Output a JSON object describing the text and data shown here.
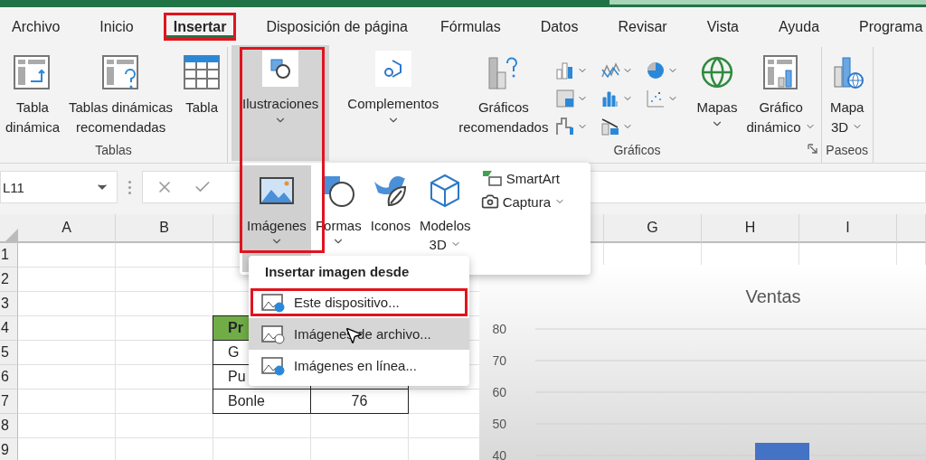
{
  "tabs": [
    {
      "label": "Archivo",
      "selected": false,
      "highlighted": false
    },
    {
      "label": "Inicio",
      "selected": false,
      "highlighted": false
    },
    {
      "label": "Insertar",
      "selected": true,
      "highlighted": true
    },
    {
      "label": "Disposición de página",
      "selected": false,
      "highlighted": false
    },
    {
      "label": "Fórmulas",
      "selected": false,
      "highlighted": false
    },
    {
      "label": "Datos",
      "selected": false,
      "highlighted": false
    },
    {
      "label": "Revisar",
      "selected": false,
      "highlighted": false
    },
    {
      "label": "Vista",
      "selected": false,
      "highlighted": false
    },
    {
      "label": "Ayuda",
      "selected": false,
      "highlighted": false
    },
    {
      "label": "Programa",
      "selected": false,
      "highlighted": false
    }
  ],
  "ribbon": {
    "groups": [
      {
        "label": "Tablas",
        "buttons": [
          {
            "kind": "large",
            "label": "Tabla\ndinámica"
          },
          {
            "kind": "large",
            "label": "Tablas dinámicas\nrecomendadas"
          },
          {
            "kind": "large",
            "label": "Tabla"
          }
        ]
      },
      {
        "buttons": [
          {
            "kind": "boxed",
            "label": "Ilustraciones",
            "dropdown": true,
            "pressed": true,
            "highlighted": true
          }
        ]
      },
      {
        "buttons": [
          {
            "kind": "boxed",
            "label": "Complementos",
            "dropdown": true,
            "pressed": false
          }
        ]
      },
      {
        "label": "Gráficos",
        "launcher": true,
        "buttons": [
          {
            "kind": "large",
            "label": "Gráficos\nrecomendados"
          },
          {
            "kind": "gallery"
          },
          {
            "kind": "large",
            "label": "Mapas",
            "dropdown": true
          },
          {
            "kind": "large",
            "label": "Gráfico\ndinámico",
            "dropdown": true
          }
        ]
      },
      {
        "label": "Paseos",
        "buttons": [
          {
            "kind": "large",
            "label": "Mapa\n3D",
            "dropdown": true
          }
        ]
      }
    ]
  },
  "formula_bar": {
    "name_box": "L11"
  },
  "illustrations_menu": {
    "items": [
      {
        "label": "Imágenes",
        "selected": true,
        "dropdown": true
      },
      {
        "label": "Formas",
        "selected": false,
        "dropdown": true
      },
      {
        "label": "Iconos",
        "selected": false,
        "dropdown": false
      },
      {
        "label": "Modelos\n3D",
        "selected": false,
        "dropdown": true
      }
    ],
    "side_items": [
      {
        "label": "SmartArt",
        "dropdown": false
      },
      {
        "label": "Captura",
        "dropdown": true
      }
    ]
  },
  "image_menu": {
    "title": "Insertar imagen desde",
    "items": [
      {
        "label": "Este dispositivo...",
        "hovered": false,
        "highlighted": true
      },
      {
        "label": "Imágenes de archivo...",
        "hovered": true,
        "highlighted": false
      },
      {
        "label": "Imágenes en línea...",
        "hovered": false,
        "highlighted": false
      }
    ]
  },
  "sheet": {
    "columns": [
      {
        "label": "A"
      },
      {
        "label": "B"
      },
      {},
      {},
      {},
      {},
      {
        "label": "G"
      },
      {
        "label": "H"
      },
      {
        "label": "I"
      },
      {}
    ],
    "rows": [
      {
        "label": "1"
      },
      {
        "label": "2"
      },
      {
        "label": "3"
      },
      {
        "label": "4",
        "cells": [
          {
            "kind": "header",
            "text": "Pr"
          },
          {
            "kind": "body"
          }
        ]
      },
      {
        "label": "5",
        "cells": [
          {
            "kind": "body",
            "text": "G"
          },
          {
            "kind": "body"
          }
        ]
      },
      {
        "label": "6",
        "cells": [
          {
            "kind": "body",
            "text": "Pu"
          },
          {
            "kind": "body"
          }
        ]
      },
      {
        "label": "7",
        "cells": [
          {
            "kind": "body",
            "text": "Bonle"
          },
          {
            "kind": "body",
            "text": "76"
          }
        ]
      },
      {
        "label": "8"
      },
      {
        "label": "9"
      }
    ]
  },
  "chart": {
    "chart_data": {
      "type": "bar",
      "title": "Ventas",
      "ylim": [
        38.57,
        80
      ],
      "yticks": [
        40,
        50,
        60,
        70,
        80
      ],
      "grid": true,
      "values": [
        44
      ]
    }
  }
}
